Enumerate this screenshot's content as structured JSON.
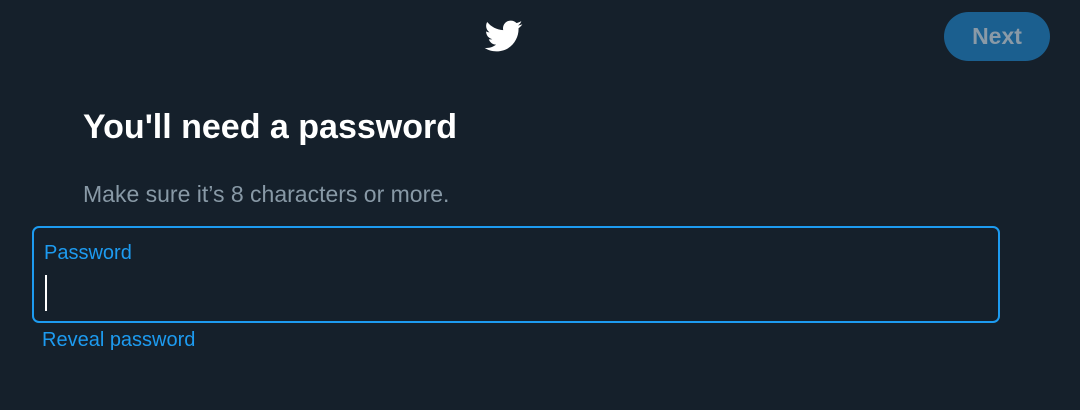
{
  "header": {
    "logo_icon": "twitter-bird-icon",
    "next_label": "Next"
  },
  "main": {
    "title": "You'll need a password",
    "subtitle": "Make sure it’s 8 characters or more.",
    "password_field": {
      "label": "Password",
      "value": ""
    },
    "reveal_label": "Reveal password"
  },
  "colors": {
    "background": "#15202b",
    "accent": "#1d9bf0",
    "button_disabled_bg": "#1b5f8f",
    "button_disabled_text": "#8a9aa7",
    "title_text": "#ffffff",
    "secondary_text": "#8899a6"
  }
}
